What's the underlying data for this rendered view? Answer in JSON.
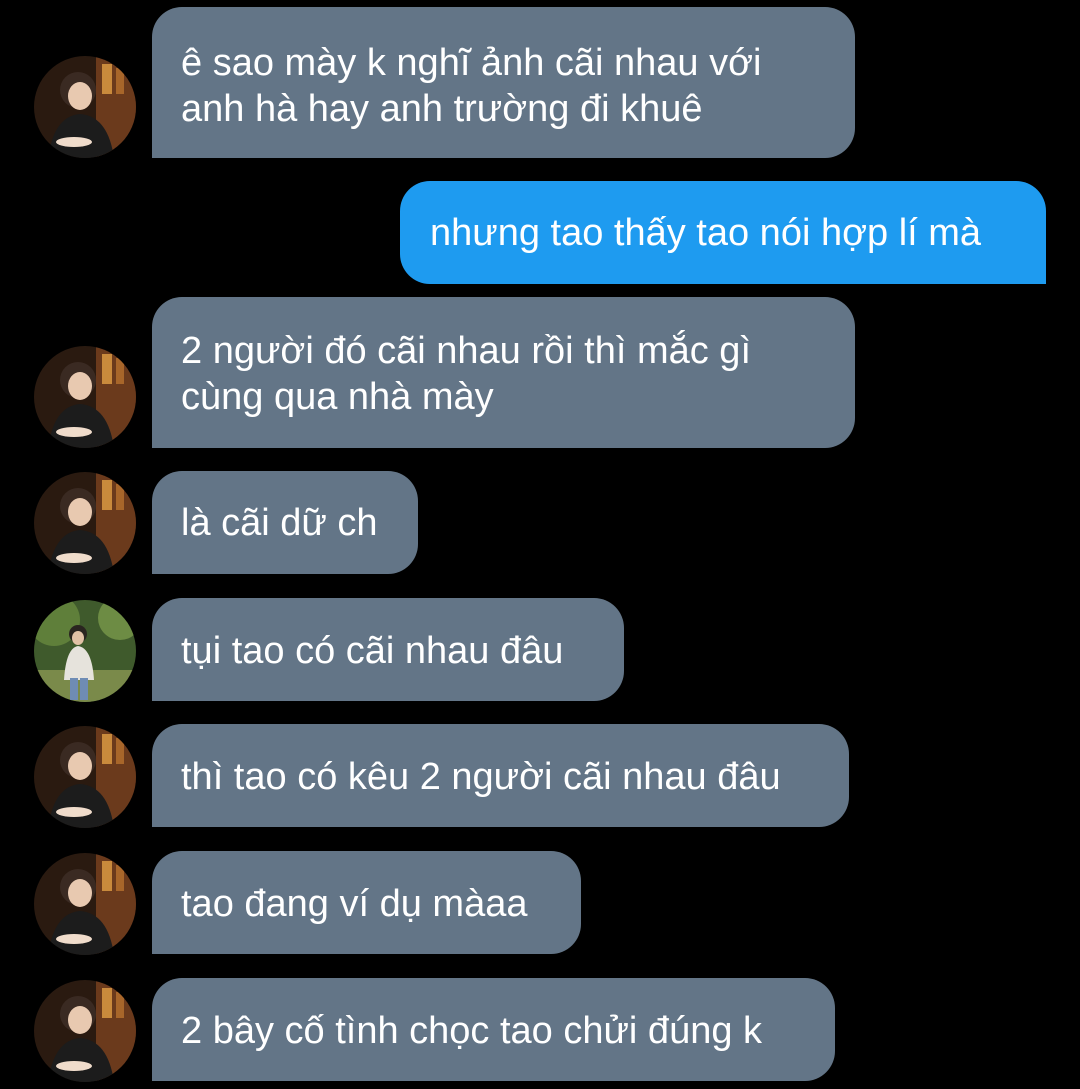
{
  "colors": {
    "background": "#000000",
    "incoming_bubble": "#637587",
    "outgoing_bubble": "#1e9bf0",
    "text": "#ffffff"
  },
  "messages": [
    {
      "direction": "incoming",
      "avatar": "dark-portrait-avatar",
      "lines": [
        "ê sao mày k nghĩ ảnh cãi nhau với",
        "anh hà hay anh trường đi khuê"
      ]
    },
    {
      "direction": "outgoing",
      "lines": [
        "nhưng tao thấy tao nói hợp lí mà"
      ]
    },
    {
      "direction": "incoming",
      "avatar": "dark-portrait-avatar",
      "lines": [
        "2 người đó cãi nhau rồi thì mắc gì",
        "cùng qua nhà mày"
      ]
    },
    {
      "direction": "incoming",
      "avatar": "dark-portrait-avatar",
      "lines": [
        "là cãi dữ ch"
      ]
    },
    {
      "direction": "incoming",
      "avatar": "outdoor-portrait-avatar",
      "lines": [
        "tụi tao có cãi nhau đâu"
      ]
    },
    {
      "direction": "incoming",
      "avatar": "dark-portrait-avatar",
      "lines": [
        "thì tao có kêu 2 người cãi nhau đâu"
      ]
    },
    {
      "direction": "incoming",
      "avatar": "dark-portrait-avatar",
      "lines": [
        "tao đang ví dụ màaa"
      ]
    },
    {
      "direction": "incoming",
      "avatar": "dark-portrait-avatar",
      "lines": [
        "2 bây cố tình chọc tao chửi đúng k"
      ]
    }
  ]
}
